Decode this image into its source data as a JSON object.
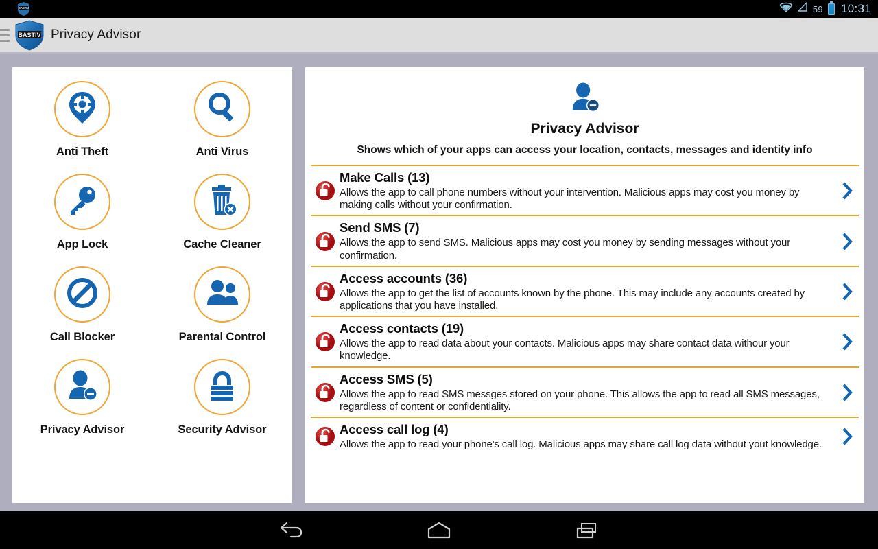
{
  "status_bar": {
    "app_icon": "bastiv-shield-icon",
    "wifi_icon": "wifi-icon",
    "signal_icon": "signal-triangle-icon",
    "battery_level": "59",
    "battery_icon": "battery-icon",
    "clock": "10:31"
  },
  "title_bar": {
    "menu_icon": "hamburger-menu-icon",
    "logo_icon": "bastiv-shield-logo",
    "logo_text": "BASTIV",
    "title": "Privacy Advisor"
  },
  "sidebar": {
    "tiles": [
      {
        "label": "Anti Theft",
        "icon": "location-pin-crosshair-icon"
      },
      {
        "label": "Anti Virus",
        "icon": "magnifying-glass-icon"
      },
      {
        "label": "App Lock",
        "icon": "key-icon"
      },
      {
        "label": "Cache Cleaner",
        "icon": "trash-can-delete-icon"
      },
      {
        "label": "Call Blocker",
        "icon": "block-prohibited-icon"
      },
      {
        "label": "Parental Control",
        "icon": "two-people-icon"
      },
      {
        "label": "Privacy Advisor",
        "icon": "person-minus-icon"
      },
      {
        "label": "Security Advisor",
        "icon": "padlock-striped-icon"
      }
    ]
  },
  "main": {
    "header": {
      "icon": "person-minus-icon",
      "title": "Privacy Advisor",
      "subtitle": "Shows which of your apps can access your location, contacts, messages and identity info"
    },
    "permissions": [
      {
        "title": "Make Calls (13)",
        "count": 13,
        "description": "Allows the app to call phone numbers without your intervention. Malicious apps may cost you money by making calls without your confirmation.",
        "lock_icon": "red-open-padlock-icon",
        "chevron_icon": "chevron-right-icon"
      },
      {
        "title": "Send SMS (7)",
        "count": 7,
        "description": "Allows the app to send SMS. Malicious apps may cost you money by sending messages without your confirmation.",
        "lock_icon": "red-open-padlock-icon",
        "chevron_icon": "chevron-right-icon"
      },
      {
        "title": "Access accounts (36)",
        "count": 36,
        "description": "Allows the app to get the list of accounts known by the phone. This may include any accounts created by applications that you have installed.",
        "lock_icon": "red-open-padlock-icon",
        "chevron_icon": "chevron-right-icon"
      },
      {
        "title": "Access contacts (19)",
        "count": 19,
        "description": "Allows the app to read data about your contacts. Malicious apps may share contact data withour your knowledge.",
        "lock_icon": "red-open-padlock-icon",
        "chevron_icon": "chevron-right-icon"
      },
      {
        "title": "Access SMS (5)",
        "count": 5,
        "description": "Allows the app to read SMS messges stored on your phone. This allows the app to read all SMS messages, regardless of content or confidentiality.",
        "lock_icon": "red-open-padlock-icon",
        "chevron_icon": "chevron-right-icon"
      },
      {
        "title": "Access call log (4)",
        "count": 4,
        "description": "Allows the app to read your phone's call log. Malicious apps may share call log data without yout knowledge.",
        "lock_icon": "red-open-padlock-icon",
        "chevron_icon": "chevron-right-icon"
      }
    ]
  },
  "nav_bar": {
    "back_icon": "back-arrow-icon",
    "home_icon": "home-icon",
    "recents_icon": "recent-apps-icon"
  },
  "colors": {
    "accent_blue": "#1565b0",
    "accent_orange": "#e3a92e",
    "lock_red": "#c0171b",
    "background": "#aeaebe",
    "panel": "#ffffff",
    "titlebar": "#dedede"
  }
}
